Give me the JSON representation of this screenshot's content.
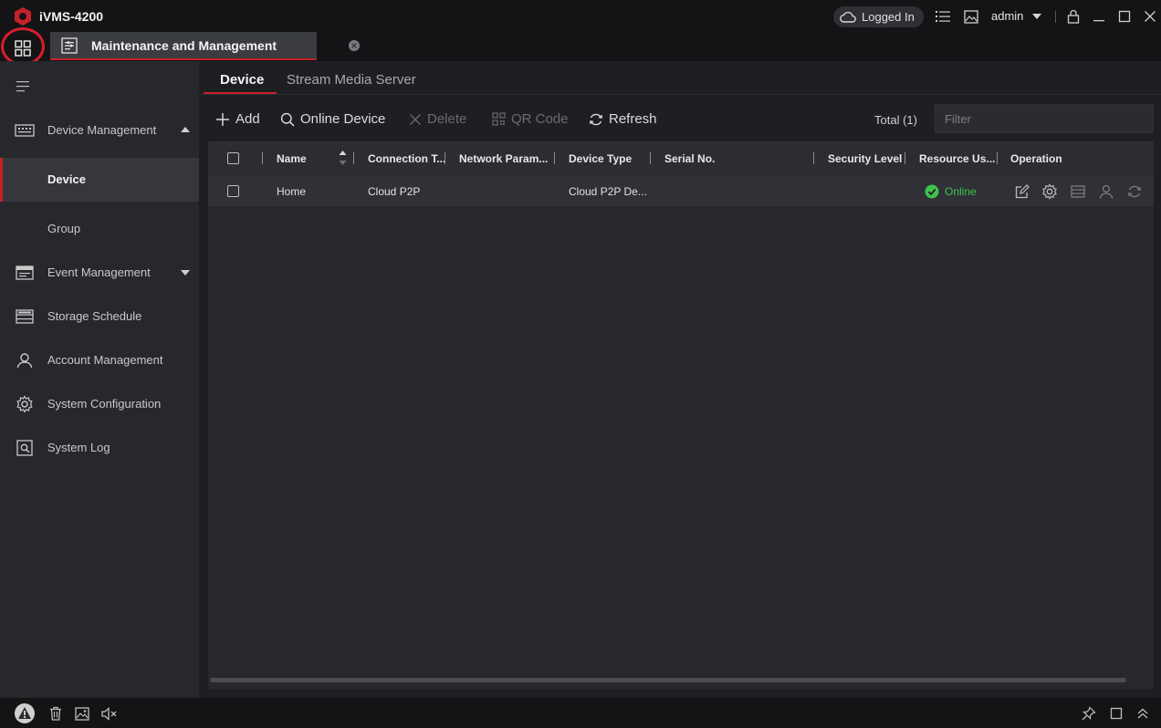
{
  "app": {
    "title": "iVMS-4200",
    "brand_color": "#c8202a"
  },
  "titlebar": {
    "logged_in_label": "Logged In",
    "user": "admin"
  },
  "page_tab": {
    "label": "Maintenance and Management"
  },
  "sidebar": {
    "items": [
      {
        "label": "Device Management",
        "icon": "device-management-icon",
        "expanded": true
      },
      {
        "label": "Device",
        "active": true
      },
      {
        "label": "Group"
      },
      {
        "label": "Event Management",
        "icon": "event-management-icon",
        "expanded": false
      },
      {
        "label": "Storage Schedule",
        "icon": "storage-schedule-icon"
      },
      {
        "label": "Account Management",
        "icon": "account-icon"
      },
      {
        "label": "System Configuration",
        "icon": "gear-icon"
      },
      {
        "label": "System Log",
        "icon": "system-log-icon"
      }
    ]
  },
  "subtabs": {
    "device": "Device",
    "stream": "Stream Media Server"
  },
  "toolbar": {
    "add": "Add",
    "online_device": "Online Device",
    "delete": "Delete",
    "qr_code": "QR Code",
    "refresh": "Refresh",
    "total": "Total (1)",
    "filter_placeholder": "Filter"
  },
  "table": {
    "columns": [
      "Name",
      "Connection T...",
      "Network Param...",
      "Device Type",
      "Serial No.",
      "Security Level",
      "Resource Us...",
      "Operation"
    ],
    "rows": [
      {
        "name": "Home",
        "connection": "Cloud P2P",
        "network": "",
        "device_type": "Cloud P2P De...",
        "serial": "",
        "security": "",
        "resource_status": "Online"
      }
    ]
  },
  "colors": {
    "online": "#3ec24b",
    "accent": "#c8202a"
  }
}
